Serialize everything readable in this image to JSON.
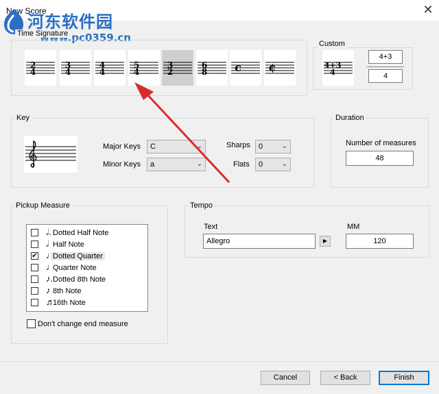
{
  "window": {
    "title": "New Score",
    "close_glyph": "✕"
  },
  "watermark": {
    "site_name": "河东软件园",
    "site_url": "www.pc0359.cn"
  },
  "time_signature": {
    "label": "Time Signature",
    "options": [
      {
        "top": "2",
        "bottom": "4",
        "symbol": ""
      },
      {
        "top": "3",
        "bottom": "4",
        "symbol": ""
      },
      {
        "top": "4",
        "bottom": "4",
        "symbol": ""
      },
      {
        "top": "5",
        "bottom": "4",
        "symbol": ""
      },
      {
        "top": "3",
        "bottom": "2",
        "symbol": ""
      },
      {
        "top": "6",
        "bottom": "8",
        "symbol": ""
      },
      {
        "top": "",
        "bottom": "",
        "symbol": "c"
      },
      {
        "top": "",
        "bottom": "",
        "symbol": "¢"
      }
    ],
    "selected_index": 4
  },
  "custom": {
    "label": "Custom",
    "preview_top": "4+3",
    "preview_bottom": "4",
    "top_value": "4+3",
    "bottom_value": "4"
  },
  "key": {
    "label": "Key",
    "major_label": "Major Keys",
    "major_value": "C",
    "minor_label": "Minor Keys",
    "minor_value": "a",
    "sharps_label": "Sharps",
    "sharps_value": "0",
    "flats_label": "Flats",
    "flats_value": "0",
    "clef_icon": "treble-clef-icon"
  },
  "duration": {
    "label": "Duration",
    "measures_label": "Number of measures",
    "measures_value": "48"
  },
  "pickup": {
    "label": "Pickup Measure",
    "items": [
      {
        "label": "Dotted Half Note",
        "glyph": "𝅗𝅥.",
        "checked": false
      },
      {
        "label": "Half Note",
        "glyph": "𝅗𝅥",
        "checked": false
      },
      {
        "label": "Dotted Quarter",
        "glyph": "♩.",
        "checked": true
      },
      {
        "label": "Quarter Note",
        "glyph": "♩",
        "checked": false
      },
      {
        "label": "Dotted 8th Note",
        "glyph": "♪.",
        "checked": false
      },
      {
        "label": "8th Note",
        "glyph": "♪",
        "checked": false
      },
      {
        "label": "16th Note",
        "glyph": "♬",
        "checked": false
      }
    ],
    "dont_change_label": "Don't change end measure",
    "check_glyph": "✔"
  },
  "tempo": {
    "label": "Tempo",
    "text_label": "Text",
    "text_value": "Allegro",
    "mm_label": "MM",
    "mm_value": "120",
    "play_glyph": "▶"
  },
  "buttons": {
    "cancel": "Cancel",
    "back": "< Back",
    "finish": "Finish"
  },
  "chevron_glyph": "⌄",
  "colors": {
    "watermark": "#2a6fc4",
    "arrow": "#d92b2b",
    "selected_tile": "#cfcfcf",
    "default_button": "#0078d7"
  }
}
